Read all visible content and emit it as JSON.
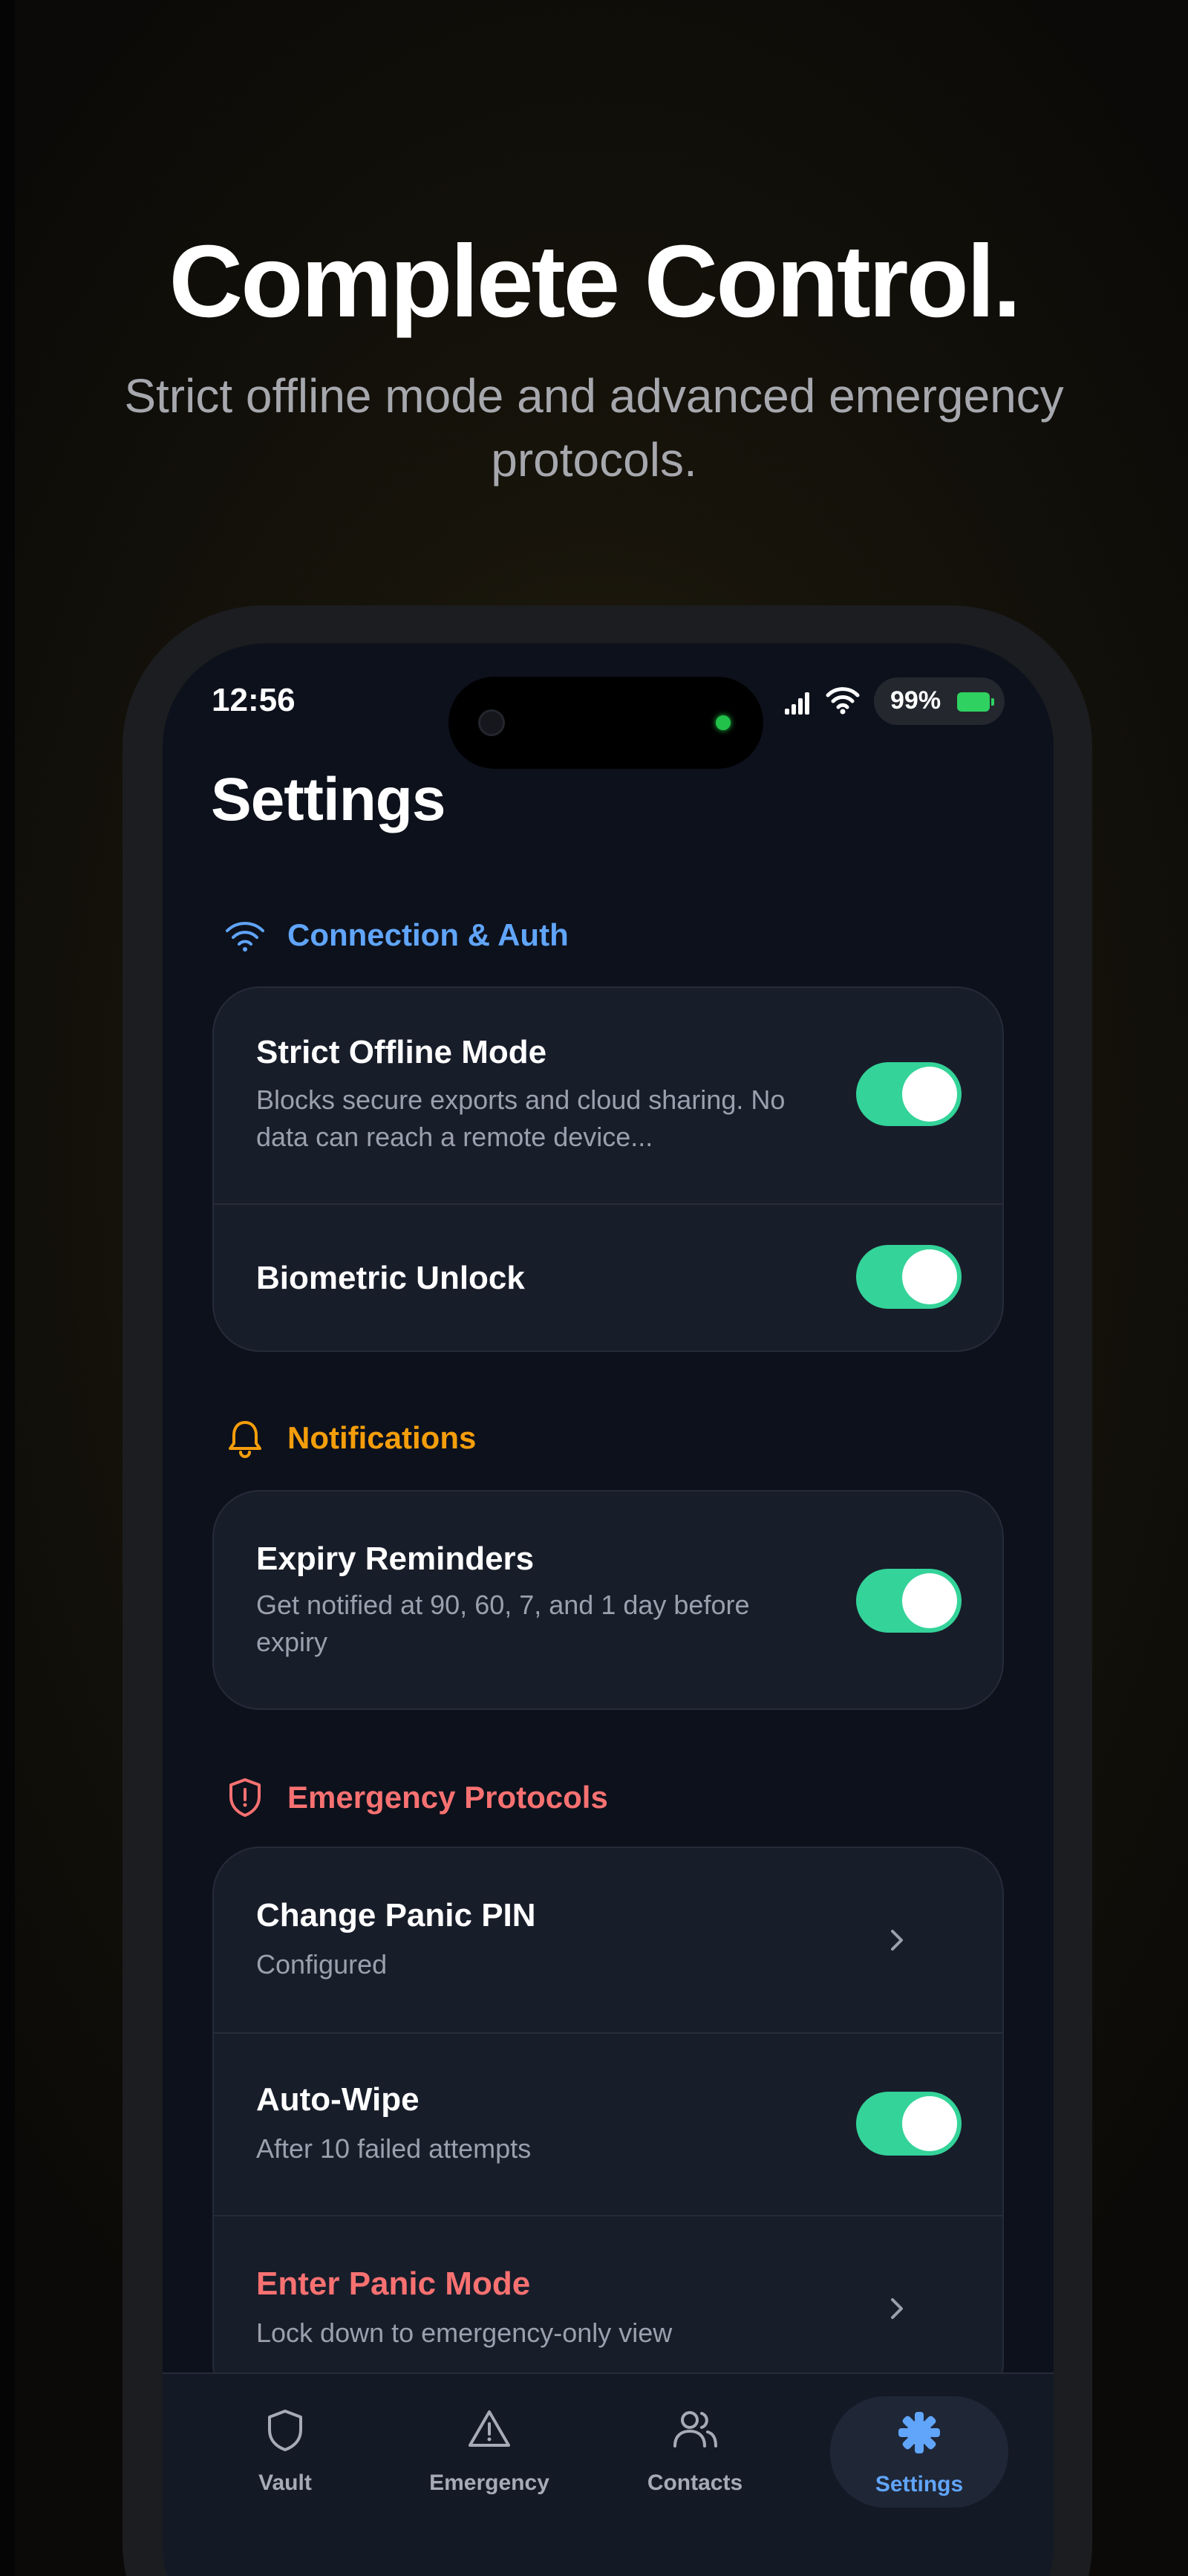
{
  "hero": {
    "headline": "Complete Control.",
    "subhead": "Strict offline mode and advanced emergency protocols."
  },
  "status_bar": {
    "time": "12:56",
    "battery": "99%"
  },
  "page": {
    "title": "Settings"
  },
  "sections": {
    "connection": {
      "title": "Connection & Auth",
      "icon": "wifi-icon",
      "color": "#60a5fa",
      "strict_offline": {
        "title": "Strict Offline Mode",
        "desc": "Blocks secure exports and cloud sharing. No data can reach a remote device...",
        "enabled": true
      },
      "biometric": {
        "title": "Biometric Unlock",
        "enabled": true
      }
    },
    "notifications": {
      "title": "Notifications",
      "icon": "bell-icon",
      "color": "#f59e0b",
      "expiry": {
        "title": "Expiry Reminders",
        "desc": "Get notified at 90, 60, 7, and 1 day before expiry",
        "enabled": true
      }
    },
    "emergency": {
      "title": "Emergency Protocols",
      "icon": "shield-alert-icon",
      "color": "#f87171",
      "panic_pin": {
        "title": "Change Panic PIN",
        "desc": "Configured"
      },
      "auto_wipe": {
        "title": "Auto-Wipe",
        "desc": "After 10 failed attempts",
        "enabled": true
      },
      "panic_mode": {
        "title": "Enter Panic Mode",
        "desc": "Lock down to emergency-only view"
      }
    }
  },
  "tabs": [
    {
      "label": "Vault",
      "icon": "shield-icon"
    },
    {
      "label": "Emergency",
      "icon": "warning-triangle-icon"
    },
    {
      "label": "Contacts",
      "icon": "users-icon"
    },
    {
      "label": "Settings",
      "icon": "gear-icon",
      "active": true
    }
  ],
  "colors": {
    "toggle_on": "#34d399",
    "accent": "#60a5fa",
    "danger": "#f87171",
    "warning": "#f59e0b"
  }
}
